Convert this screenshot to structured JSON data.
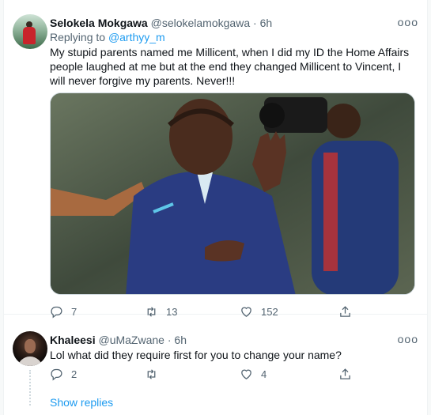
{
  "main_tweet": {
    "name": "Selokela Mokgawa",
    "handle": "@selokelamokgawa",
    "separator": "·",
    "time": "6h",
    "more": "ooo",
    "replying_prefix": "Replying to",
    "replying_to": "@arthyy_m",
    "text": "My stupid parents named me Millicent, when I did my ID the Home Affairs people laughed at me but at the end they changed Millicent to Vincent, I will never forgive my parents. Never!!!",
    "actions": {
      "replies": "7",
      "retweets": "13",
      "likes": "152"
    }
  },
  "reply_tweet": {
    "name": "Khaleesi",
    "handle": "@uMaZwane",
    "separator": "·",
    "time": "6h",
    "more": "ooo",
    "text": "Lol what did they require first for you to change your name?",
    "actions": {
      "replies": "2",
      "retweets": "",
      "likes": "4"
    }
  },
  "show_replies": "Show replies",
  "icons": [
    "reply-icon",
    "retweet-icon",
    "like-icon",
    "share-icon"
  ],
  "colors": {
    "accent": "#1d9bf0",
    "secondary_text": "#536471",
    "primary_text": "#0f1419"
  }
}
